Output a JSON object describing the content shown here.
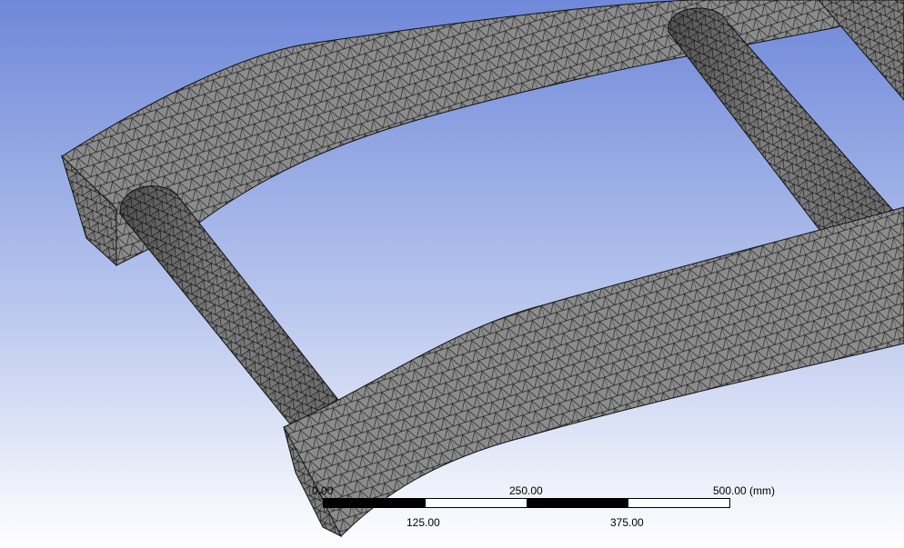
{
  "viewport": {
    "background_top": "#7089d8",
    "background_bottom": "#ffffff",
    "mesh_fill": "#8a8a8a",
    "mesh_line": "#1a1a1a"
  },
  "scale_bar": {
    "top_labels": [
      "0.00",
      "250.00",
      "500.00 (mm)"
    ],
    "bottom_labels": [
      "125.00",
      "375.00"
    ],
    "segments": [
      "black",
      "white",
      "black",
      "white"
    ]
  }
}
